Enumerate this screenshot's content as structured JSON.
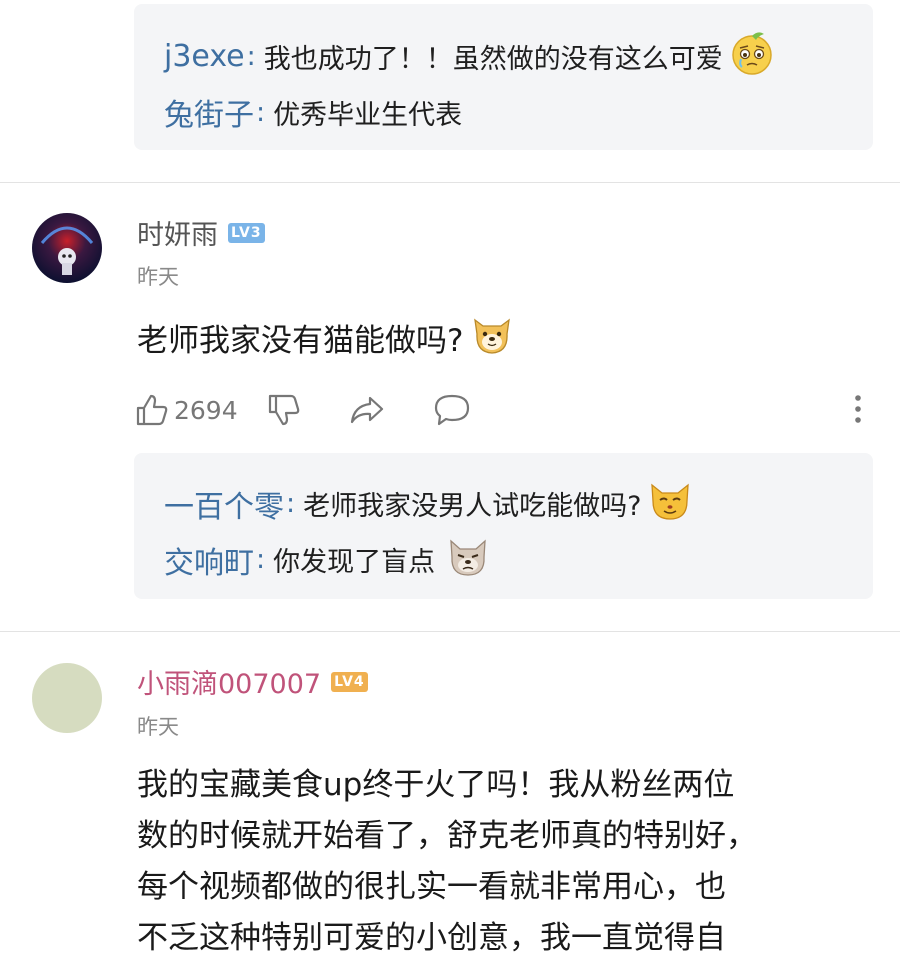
{
  "thread1": {
    "replies": [
      {
        "name": "j3exe",
        "text": "我也成功了！！虽然做的没有这么可爱",
        "emoji": "crying-face-icon"
      },
      {
        "name": "兔街子",
        "text": "优秀毕业生代表"
      }
    ]
  },
  "comment1": {
    "username": "时妍雨",
    "level": "LV3",
    "date": "昨天",
    "text": "老师我家没有猫能做吗?",
    "emoji": "doge-icon",
    "likes": "2694",
    "replies": [
      {
        "name": "一百个零",
        "text": "老师我家没男人试吃能做吗?",
        "emoji": "cat-face-icon"
      },
      {
        "name": "交响町",
        "text": "你发现了盲点",
        "emoji": "sad-doge-icon"
      }
    ]
  },
  "comment2": {
    "username": "小雨滴007007",
    "level": "LV4",
    "date": "昨天",
    "lines": [
      "我的宝藏美食up终于火了吗！我从粉丝两位",
      "数的时候就开始看了，舒克老师真的特别好，",
      "每个视频都做的很扎实一看就非常用心，也",
      "不乏这种特别可爱的小创意，我一直觉得自"
    ]
  },
  "colors": {
    "reply_name": "#3e6fa1",
    "vip_name": "#c0537a",
    "reply_bg": "#f4f5f7",
    "lv3": "#7ab4e8",
    "lv4": "#f0b050"
  }
}
